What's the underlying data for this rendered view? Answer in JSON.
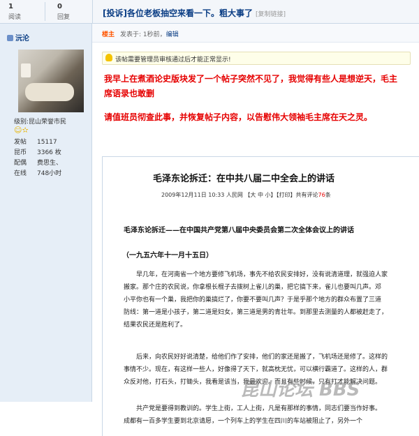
{
  "stats": {
    "views": {
      "num": "1",
      "label": "阅读"
    },
    "replies": {
      "num": "0",
      "label": "回复"
    }
  },
  "thread": {
    "title": "[投诉]各位老板抽空来看一下。粗大事了",
    "copy_link": "[复制链接]"
  },
  "user": {
    "name": "沅沦",
    "level_label": "级别:",
    "level": "昆山荣誉市民",
    "stars": "☺✫",
    "info": [
      {
        "k": "发帖",
        "v": "15117"
      },
      {
        "k": "昆币",
        "v": "3366 枚"
      },
      {
        "k": "配偶",
        "v": "费思生、"
      },
      {
        "k": "在线",
        "v": "748小时"
      }
    ]
  },
  "post": {
    "author_tag": "楼主",
    "posted": "发表于: 1秒前，",
    "edit": "编辑",
    "notice": "该帖需要管理员审核通过后才能正常显示!",
    "red_lines": [
      "我早上在煮酒论史版块发了一个帖子突然不见了，我觉得有些人是想逆天，毛主",
      "席语录也敢删",
      "请值班员彻查此事，并恢复帖子内容，以告慰伟大领袖毛主席在天之灵。"
    ]
  },
  "article": {
    "title": "毛泽东论拆迁：在中共八届二中全会上的讲话",
    "meta": "2009年12月11日 10:33 人民网 【大 中 小】【打印】共有评论",
    "comment_count": "76",
    "meta_suffix": "条",
    "subtitle": "毛泽东论拆迁——在中国共产党第八届中央委员会第二次全体会议上的讲话",
    "date": "（一九五六年十一月十五日）",
    "paragraphs": [
      [
        "早几年，在河南省一个地方要修飞机场，事先不给农民安排好，没有说清道理，就强迫人家",
        "搬家。那个庄的农民说，你拿根长棍子去拨树上雀儿的巢，把它搞下来，雀儿也要叫几声。邓",
        "小平你也有一个巢，我把你的巢搞烂了，你要不要叫几声？于是乎那个地方的群众布置了三道",
        "防线：第一道是小孩子，第二道是妇女，第三道是男的青壮年。到那里去测量的人都被赶走了，",
        "结果农民还是胜利了。"
      ],
      [
        "后来，向农民好好说清楚，给他们作了安排，他们的家还是搬了，飞机场还是修了。这样的",
        "事情不少。现在，有这样一些人，好像得了天下，就高枕无忧，可以横行霸道了。这样的人，群",
        "众反对他，打石头，打锄头，我看是该当，我最欢迎。而且有些时候，只有打才能解决问题。"
      ],
      [
        "共产党是要得到教训的。学生上街，工人上街，凡是有那样的事情，同志们要当作好事。",
        "成都有一百多学生要到北京请愿，一个列车上的学生在四川的车站被阻止了，另外一个"
      ]
    ]
  },
  "watermark": "昆山论坛 BBS"
}
